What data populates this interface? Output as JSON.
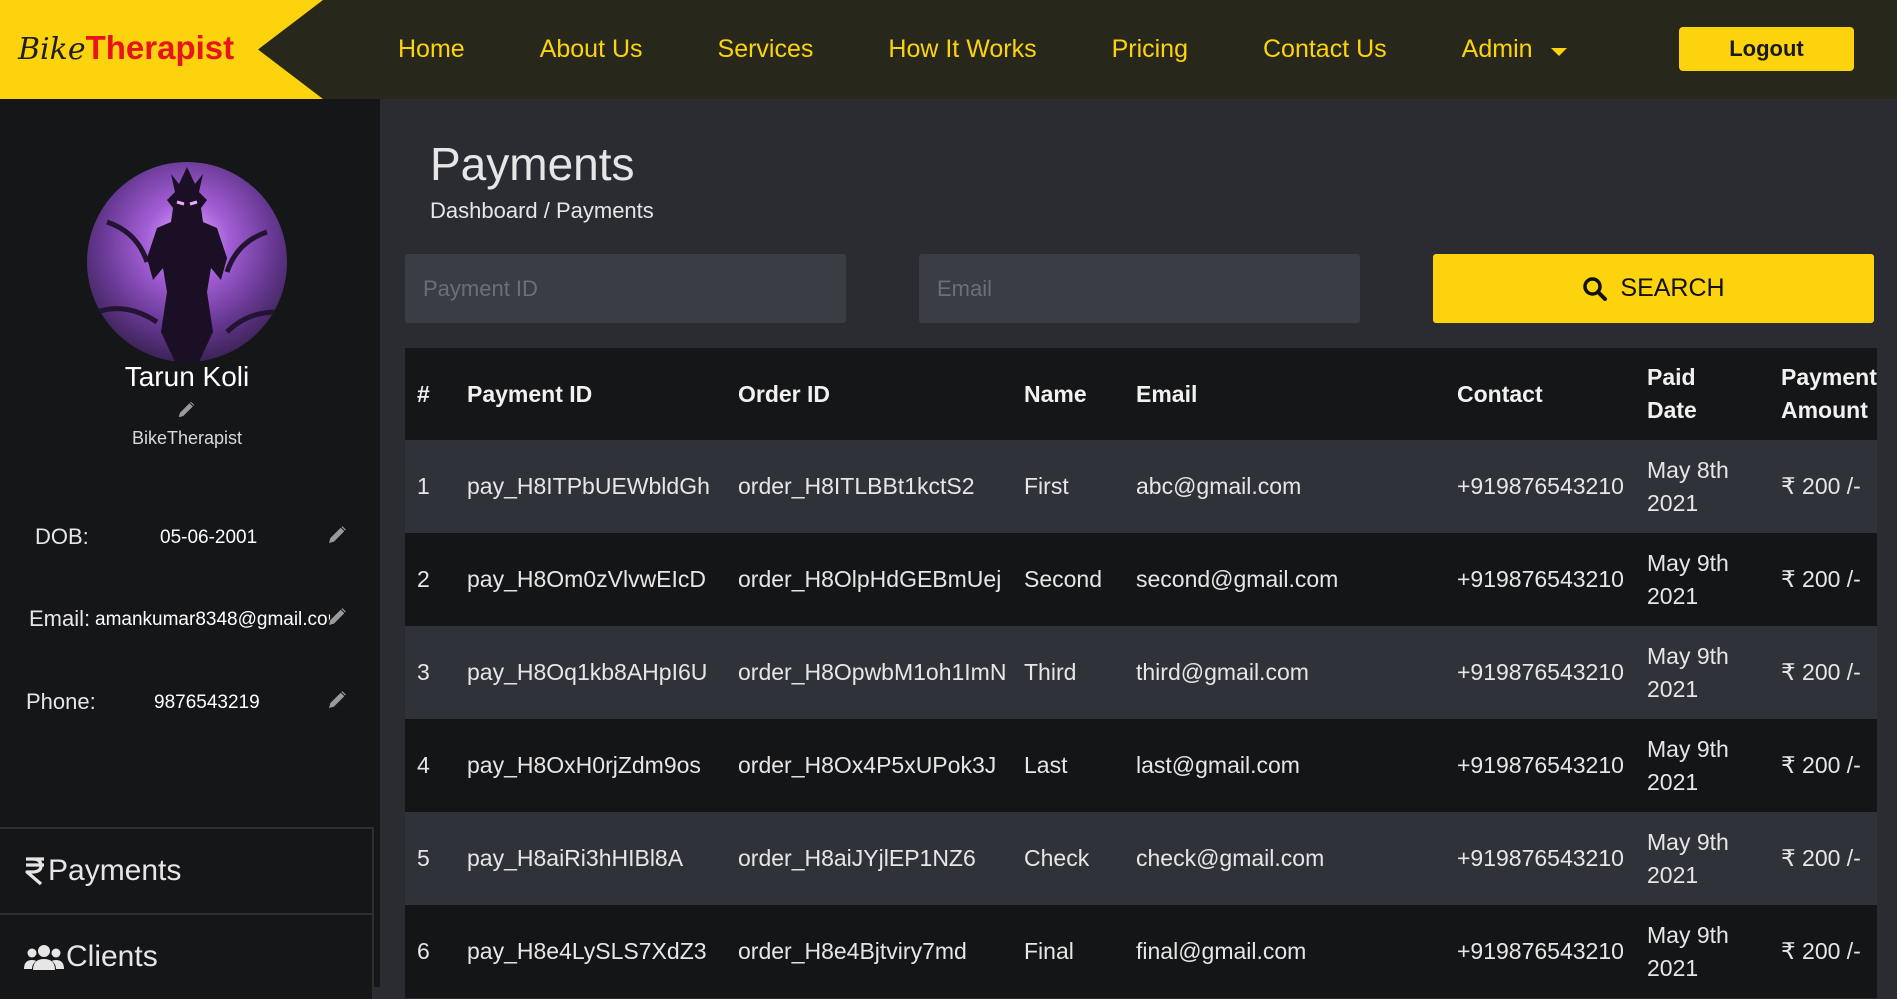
{
  "brand": {
    "part1": "Bike",
    "part2": "Therapist"
  },
  "nav": {
    "links": [
      "Home",
      "About Us",
      "Services",
      "How It Works",
      "Pricing",
      "Contact Us"
    ],
    "admin": "Admin",
    "logout": "Logout"
  },
  "profile": {
    "name": "Tarun Koli",
    "org": "BikeTherapist",
    "dob_label": "DOB:",
    "dob": "05-06-2001",
    "email_label": "Email:",
    "email": "amankumar8348@gmail.com",
    "phone_label": "Phone:",
    "phone": "9876543219"
  },
  "menu": {
    "payments": "Payments",
    "clients": "Clients"
  },
  "page": {
    "title": "Payments",
    "breadcrumb": "Dashboard / Payments"
  },
  "filters": {
    "payment_id_placeholder": "Payment ID",
    "email_placeholder": "Email",
    "search_label": "SEARCH"
  },
  "table": {
    "headers": [
      "#",
      "Payment ID",
      "Order ID",
      "Name",
      "Email",
      "Contact",
      "Paid Date",
      "Payment Amount"
    ],
    "rows": [
      [
        "1",
        "pay_H8ITPbUEWbldGh",
        "order_H8ITLBBt1kctS2",
        "First",
        "abc@gmail.com",
        "+919876543210",
        "May 8th 2021",
        "₹ 200 /-"
      ],
      [
        "2",
        "pay_H8Om0zVlvwEIcD",
        "order_H8OlpHdGEBmUej",
        "Second",
        "second@gmail.com",
        "+919876543210",
        "May 9th 2021",
        "₹ 200 /-"
      ],
      [
        "3",
        "pay_H8Oq1kb8AHpI6U",
        "order_H8OpwbM1oh1ImN",
        "Third",
        "third@gmail.com",
        "+919876543210",
        "May 9th 2021",
        "₹ 200 /-"
      ],
      [
        "4",
        "pay_H8OxH0rjZdm9os",
        "order_H8Ox4P5xUPok3J",
        "Last",
        "last@gmail.com",
        "+919876543210",
        "May 9th 2021",
        "₹ 200 /-"
      ],
      [
        "5",
        "pay_H8aiRi3hHIBl8A",
        "order_H8aiJYjlEP1NZ6",
        "Check",
        "check@gmail.com",
        "+919876543210",
        "May 9th 2021",
        "₹ 200 /-"
      ],
      [
        "6",
        "pay_H8e4LySLS7XdZ3",
        "order_H8e4Bjtviry7md",
        "Final",
        "final@gmail.com",
        "+919876543210",
        "May 9th 2021",
        "₹ 200 /-"
      ]
    ]
  },
  "colors": {
    "accent": "#fcd30d",
    "navbar": "#27281b",
    "sidebar": "#151618",
    "main": "#2a2c31",
    "logo_red": "#e8141b"
  },
  "icons": {
    "menu_payments": "rupee-icon",
    "menu_clients": "users-icon",
    "edit": "pencil-icon",
    "search": "search-icon",
    "dropdown": "caret-down-icon"
  }
}
